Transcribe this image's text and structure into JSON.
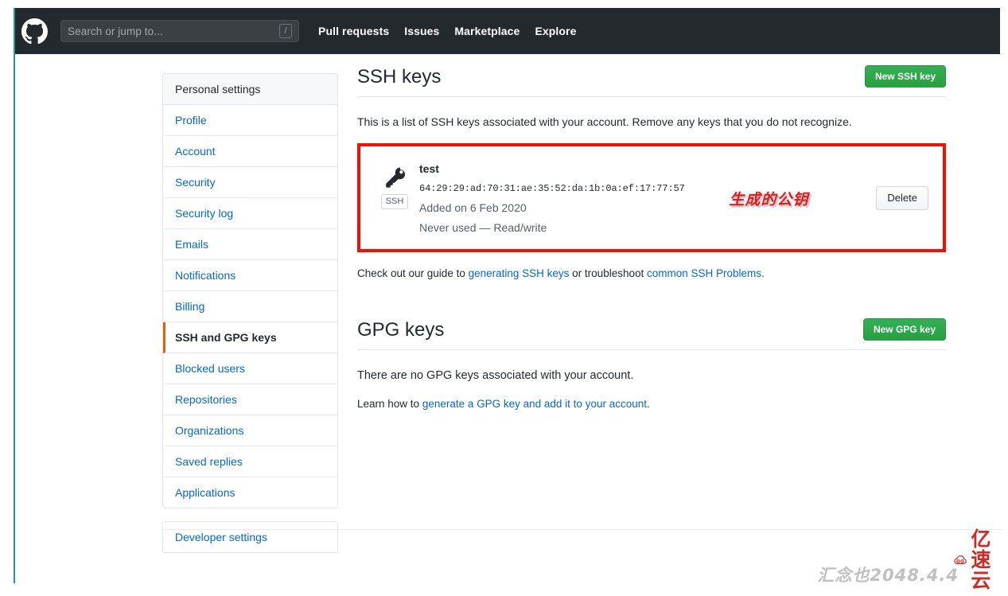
{
  "header": {
    "logo_icon": "github-mark-icon",
    "search": {
      "placeholder": "Search or jump to...",
      "value": "",
      "shortcut": "/"
    },
    "nav": [
      {
        "label": "Pull requests"
      },
      {
        "label": "Issues"
      },
      {
        "label": "Marketplace"
      },
      {
        "label": "Explore"
      }
    ]
  },
  "sidebar": {
    "heading": "Personal settings",
    "items": [
      {
        "label": "Profile",
        "selected": false
      },
      {
        "label": "Account",
        "selected": false
      },
      {
        "label": "Security",
        "selected": false
      },
      {
        "label": "Security log",
        "selected": false
      },
      {
        "label": "Emails",
        "selected": false
      },
      {
        "label": "Notifications",
        "selected": false
      },
      {
        "label": "Billing",
        "selected": false
      },
      {
        "label": "SSH and GPG keys",
        "selected": true
      },
      {
        "label": "Blocked users",
        "selected": false
      },
      {
        "label": "Repositories",
        "selected": false
      },
      {
        "label": "Organizations",
        "selected": false
      },
      {
        "label": "Saved replies",
        "selected": false
      },
      {
        "label": "Applications",
        "selected": false
      }
    ],
    "developer_settings": "Developer settings"
  },
  "ssh_section": {
    "title": "SSH keys",
    "new_button": "New SSH key",
    "description": "This is a list of SSH keys associated with your account. Remove any keys that you do not recognize.",
    "keys": [
      {
        "icon": "key-icon",
        "badge": "SSH",
        "title": "test",
        "fingerprint": "64:29:29:ad:70:31:ae:35:52:da:1b:0a:ef:17:77:57",
        "added": "Added on 6 Feb 2020",
        "usage": "Never used — Read/write",
        "delete_label": "Delete"
      }
    ],
    "annotation": {
      "text": "生成的公钥",
      "color": "#e01e1e",
      "highlight_box_color": "#f50e02"
    },
    "helper": {
      "prefix": "Check out our guide to ",
      "link1": "generating SSH keys",
      "middle": " or troubleshoot ",
      "link2": "common SSH Problems",
      "suffix": "."
    }
  },
  "gpg_section": {
    "title": "GPG keys",
    "new_button": "New GPG key",
    "description": "There are no GPG keys associated with your account.",
    "learn": {
      "prefix": "Learn how to ",
      "link": "generate a GPG key and add it to your account",
      "suffix": "."
    }
  },
  "watermark": {
    "ghost_text": "汇念也2048.4.4",
    "brand_name": "亿速云",
    "brand_color": "#cf2a24"
  },
  "theme": {
    "header_bg": "#24292e",
    "link_blue": "#0366d6",
    "green_button": "#28a745",
    "active_accent": "#e36209",
    "page_edge": "#1c9c9c"
  }
}
